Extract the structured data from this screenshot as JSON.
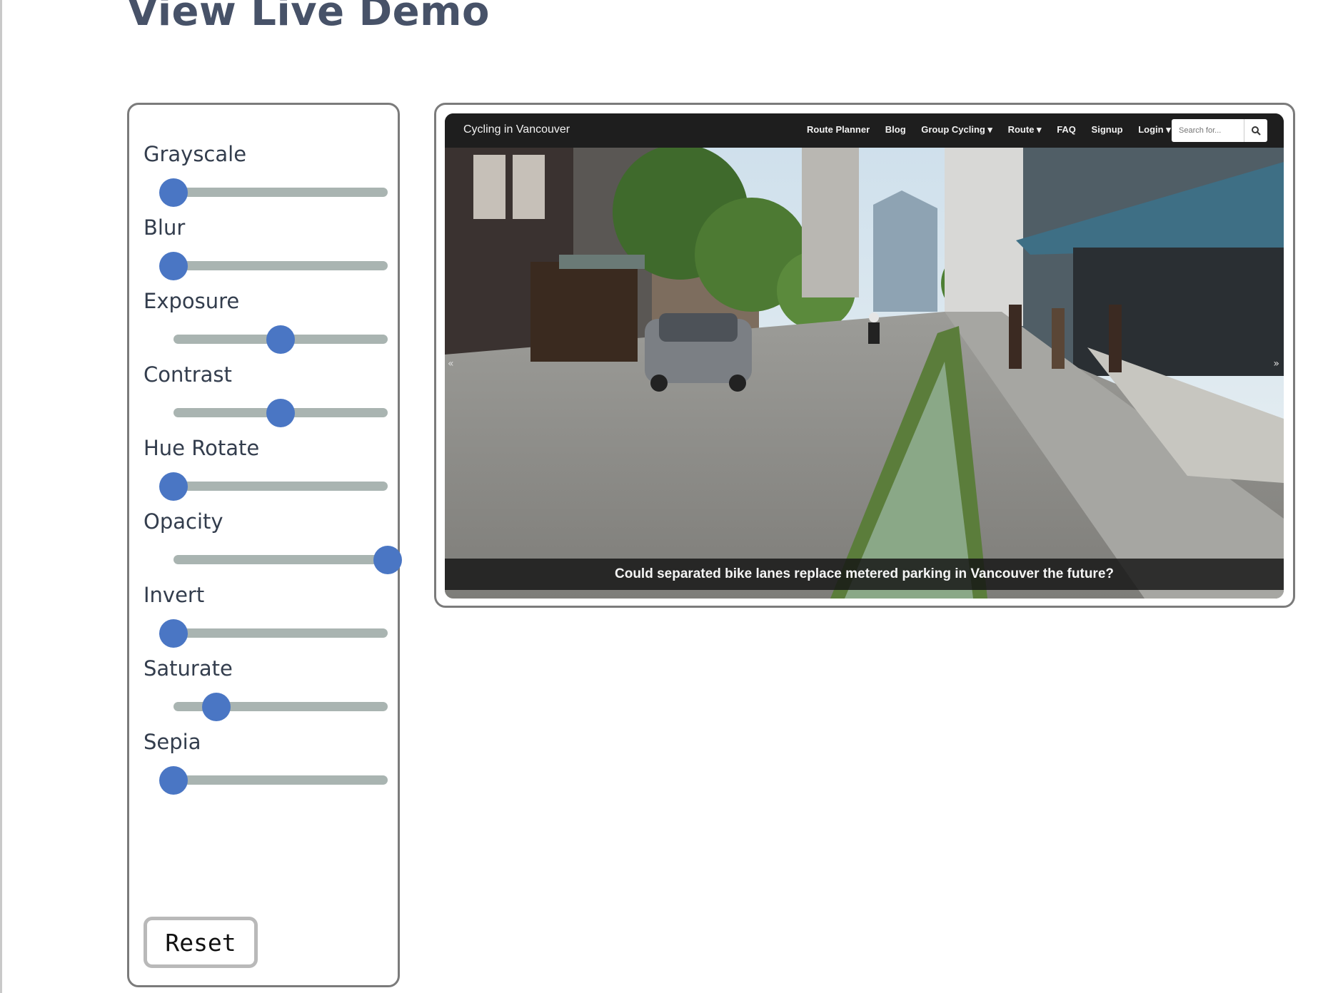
{
  "page": {
    "title": "View Live Demo"
  },
  "controls": [
    {
      "label": "Grayscale",
      "value": 0
    },
    {
      "label": "Blur",
      "value": 0
    },
    {
      "label": "Exposure",
      "value": 0.5
    },
    {
      "label": "Contrast",
      "value": 0.5
    },
    {
      "label": "Hue Rotate",
      "value": 0
    },
    {
      "label": "Opacity",
      "value": 1
    },
    {
      "label": "Invert",
      "value": 0
    },
    {
      "label": "Saturate",
      "value": 0.2
    },
    {
      "label": "Sepia",
      "value": 0
    }
  ],
  "reset_label": "Reset",
  "preview": {
    "brand": "Cycling in Vancouver",
    "nav": [
      "Route Planner",
      "Blog",
      "Group Cycling ▾",
      "Route ▾",
      "FAQ",
      "Signup",
      "Login ▾"
    ],
    "search_placeholder": "Search for...",
    "caption": "Could separated bike lanes replace metered parking in Vancouver the future?"
  },
  "colors": {
    "accent": "#4a76c4",
    "track": "#a9b4b1",
    "title": "#475268",
    "border": "#7b7b7b"
  }
}
